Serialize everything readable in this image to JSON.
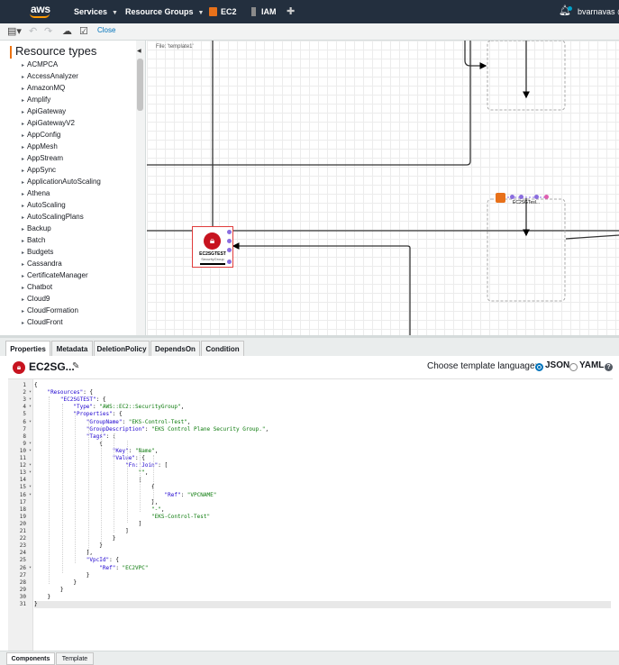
{
  "topnav": {
    "logo": "aws",
    "services": "Services",
    "resource_groups": "Resource Groups",
    "ec2": "EC2",
    "iam": "IAM",
    "user": "bvarnavas @"
  },
  "toolbar": {
    "icons": [
      "file-menu-icon",
      "undo-icon",
      "redo-icon",
      "cloud-upload-icon",
      "validate-icon"
    ],
    "close_label": "Close"
  },
  "resource_types": {
    "title": "Resource types",
    "items": [
      "ACMPCA",
      "AccessAnalyzer",
      "AmazonMQ",
      "Amplify",
      "ApiGateway",
      "ApiGatewayV2",
      "AppConfig",
      "AppMesh",
      "AppStream",
      "AppSync",
      "ApplicationAutoScaling",
      "Athena",
      "AutoScaling",
      "AutoScalingPlans",
      "Backup",
      "Batch",
      "Budgets",
      "Cassandra",
      "CertificateManager",
      "Chatbot",
      "Cloud9",
      "CloudFormation",
      "CloudFront"
    ]
  },
  "canvas": {
    "file_label": "File: 'template1'",
    "sg_node": {
      "name": "EC2SGTEST",
      "type": "SecurityGroup"
    },
    "ec2_node": {
      "name": "EC2SGTesl..."
    }
  },
  "properties_tabs": [
    "Properties",
    "Metadata",
    "DeletionPolicy",
    "DependsOn",
    "Condition"
  ],
  "editor": {
    "resource_name": "EC2SG...",
    "language_prompt": "Choose template language:",
    "json_label": "JSON",
    "yaml_label": "YAML",
    "selected_language": "JSON",
    "lines": [
      "{",
      "    \"Resources\": {",
      "        \"EC2SGTEST\": {",
      "            \"Type\": \"AWS::EC2::SecurityGroup\",",
      "            \"Properties\": {",
      "                \"GroupName\": \"EKS-Control-Test\",",
      "                \"GroupDescription\": \"EKS Control Plane Security Group.\",",
      "                \"Tags\": [",
      "                    {",
      "                        \"Key\": \"Name\",",
      "                        \"Value\": {",
      "                            \"Fn::Join\": [",
      "                                \"\",",
      "                                [",
      "                                    {",
      "                                        \"Ref\": \"VPCNAME\"",
      "                                    },",
      "                                    \"-\",",
      "                                    \"EKS-Control-Test\"",
      "                                ]",
      "                            ]",
      "                        }",
      "                    }",
      "                ],",
      "                \"VpcId\": {",
      "                    \"Ref\": \"EC2VPC\"",
      "                }",
      "            }",
      "        }",
      "    }",
      "}"
    ],
    "folds": [
      1,
      2,
      3,
      5,
      8,
      9,
      11,
      12,
      14,
      15,
      25
    ]
  },
  "bottom_tabs": [
    "Components",
    "Template"
  ],
  "colors": {
    "nav_bg": "#232f3e",
    "accent": "#ec7211",
    "link": "#0073bb",
    "sg_red": "#c7131f",
    "port": "#8a6ddf"
  }
}
